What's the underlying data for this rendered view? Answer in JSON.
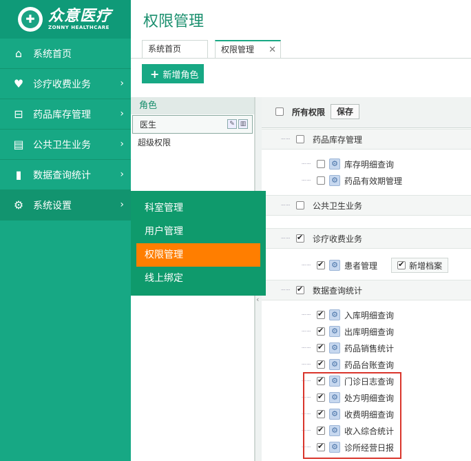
{
  "logo": {
    "cn": "众意医疗",
    "en": "ZONNY HEALTHCARE"
  },
  "sidebar": {
    "items": [
      {
        "label": "系统首页",
        "icon": "home-icon",
        "glyph": "⌂",
        "arrow": ""
      },
      {
        "label": "诊疗收费业务",
        "icon": "heart-plus-icon",
        "glyph": "♥",
        "arrow": "›"
      },
      {
        "label": "药品库存管理",
        "icon": "medicine-box-icon",
        "glyph": "⊟",
        "arrow": "›"
      },
      {
        "label": "公共卫生业务",
        "icon": "clipboard-icon",
        "glyph": "▤",
        "arrow": "›"
      },
      {
        "label": "数据查询统计",
        "icon": "bar-chart-icon",
        "glyph": "▮",
        "arrow": "›"
      },
      {
        "label": "系统设置",
        "icon": "gear-icon",
        "glyph": "⚙",
        "arrow": "›"
      }
    ]
  },
  "flyout": {
    "items": [
      "科室管理",
      "用户管理",
      "权限管理",
      "线上绑定"
    ],
    "current": "权限管理"
  },
  "header": {
    "title": "权限管理"
  },
  "tabs": [
    {
      "label": "系统首页"
    },
    {
      "label": "权限管理",
      "close": "✕"
    }
  ],
  "toolbar": {
    "add_role": "新增角色",
    "add_icon": "+"
  },
  "roles": {
    "header": "角色",
    "items": [
      "医生",
      "超级权限"
    ]
  },
  "perm": {
    "all_label": "所有权限",
    "save_label": "保存",
    "groups": [
      {
        "label": "药品库存管理",
        "checked": false,
        "children": [
          {
            "label": "库存明细查询",
            "checked": false
          },
          {
            "label": "药品有效期管理",
            "checked": false
          }
        ]
      },
      {
        "label": "公共卫生业务",
        "checked": false,
        "children": []
      },
      {
        "label": "诊疗收费业务",
        "checked": true,
        "children": [
          {
            "label": "患者管理",
            "checked": true,
            "extra": {
              "label": "新增档案",
              "checked": true
            }
          }
        ]
      },
      {
        "label": "数据查询统计",
        "checked": true,
        "children": [
          {
            "label": "入库明细查询",
            "checked": true
          },
          {
            "label": "出库明细查询",
            "checked": true
          },
          {
            "label": "药品销售统计",
            "checked": true
          },
          {
            "label": "药品台账查询",
            "checked": true
          },
          {
            "label": "门诊日志查询",
            "checked": true
          },
          {
            "label": "处方明细查询",
            "checked": true
          },
          {
            "label": "收费明细查询",
            "checked": true
          },
          {
            "label": "收入综合统计",
            "checked": true
          },
          {
            "label": "诊所经营日报",
            "checked": true
          }
        ]
      }
    ]
  },
  "colors": {
    "brand": "#17a884",
    "highlight": "#ff7e00",
    "annotation": "#d9342b"
  }
}
